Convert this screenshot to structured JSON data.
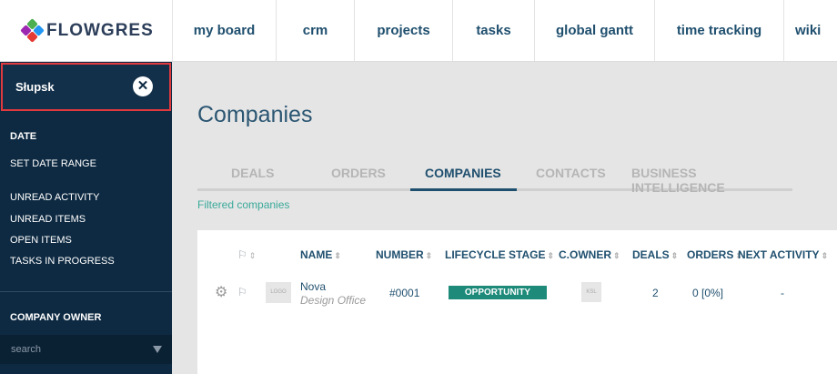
{
  "app": {
    "brand": "FLOWGRES"
  },
  "nav": {
    "items": [
      "my board",
      "crm",
      "projects",
      "tasks",
      "global gantt",
      "time tracking",
      "wiki"
    ]
  },
  "sidebar": {
    "active_filter": "Słupsk",
    "date_label": "DATE",
    "set_date_range": "SET DATE RANGE",
    "unread_activity": "UNREAD ACTIVITY",
    "unread_items": "UNREAD ITEMS",
    "open_items": "OPEN ITEMS",
    "tasks_in_progress": "TASKS IN PROGRESS",
    "company_owner": "COMPANY OWNER",
    "search_placeholder": "search"
  },
  "main": {
    "title": "Companies",
    "tabs": [
      "DEALS",
      "ORDERS",
      "COMPANIES",
      "CONTACTS",
      "BUSINESS INTELLIGENCE"
    ],
    "active_tab": "COMPANIES",
    "filtered_label": "Filtered companies"
  },
  "table": {
    "headers": {
      "name": "NAME",
      "number": "NUMBER",
      "lifecycle": "LIFECYCLE STAGE",
      "owner": "C.OWNER",
      "deals": "DEALS",
      "orders": "ORDERS",
      "next_activity": "NEXT ACTIVITY"
    },
    "rows": [
      {
        "logo_placeholder": "LOGO",
        "name": "Nova",
        "subtitle": "Design Office",
        "number": "#0001",
        "lifecycle": "OPPORTUNITY",
        "owner_initials": "KSL",
        "deals": "2",
        "orders": "0 [0%]",
        "next_activity": "-"
      }
    ]
  },
  "colors": {
    "navy": "#0e2a42",
    "accent": "#1f4f6e",
    "teal": "#1d8a7a",
    "highlight": "#e0393e"
  }
}
